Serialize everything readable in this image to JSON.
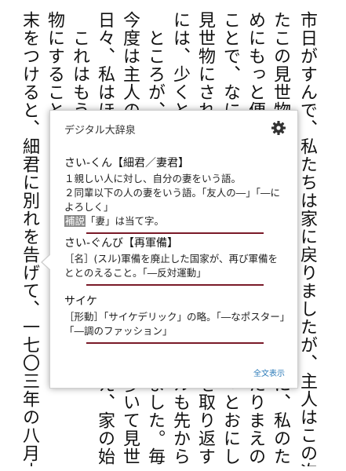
{
  "book": {
    "columns": [
      {
        "top": "市日がすんで、私たちは家に戻りましたが、主人はこの次の市日にも、ま"
      },
      {
        "top": "たこの見世物",
        "bottom": "に、私のた"
      },
      {
        "top": "めにもっと便利",
        "bottom": "たりまえの"
      },
      {
        "top": "ことで、なにぶ",
        "bottom": "っとおにし"
      },
      {
        "top": "見世物にされた",
        "bottom": "を取り返す"
      },
      {
        "top": "には、少くとも",
        "bottom": "ルも先から、"
      },
      {
        "top": "　ところが、私",
        "bottom": "ました。毎"
      },
      {
        "top": "今度は主人の家",
        "bottom": "歩いて見世"
      },
      {
        "top": "日々、私はほ",
        "bottom": "え、家の始"
      },
      {
        "top": "　これはもうか",
        "bottom": ""
      },
      {
        "top": "物にすることを",
        "bottom": ""
      },
      {
        "top": "末をつけると、細君に別れを告げて、一七〇三年の八月十七日（これは私が"
      }
    ]
  },
  "popup": {
    "title": "デジタル大辞泉",
    "settings_icon": "gear-icon",
    "full_text_link": "全文表示",
    "accent_color": "#7a1a28",
    "link_color": "#2a7ab8",
    "entries": [
      {
        "headword": "さい-くん【細君／妻君】",
        "lines": [
          "１親しい人に対し、自分の妻をいう語。",
          "２同輩以下の人の妻をいう語。「友人の―」「―によろしく」"
        ],
        "note_tag": "補説",
        "note_text": "「妻」は当て字。"
      },
      {
        "headword": "さい-ぐんび【再軍備】",
        "lines": [
          "［名］(スル)軍備を廃止した国家が、再び軍備をととのえること。「―反対運動」"
        ]
      },
      {
        "headword": "サイケ",
        "lines": [
          "［形動］「サイケデリック」の略。「―なポスター」「―調のファッション」"
        ]
      }
    ]
  }
}
